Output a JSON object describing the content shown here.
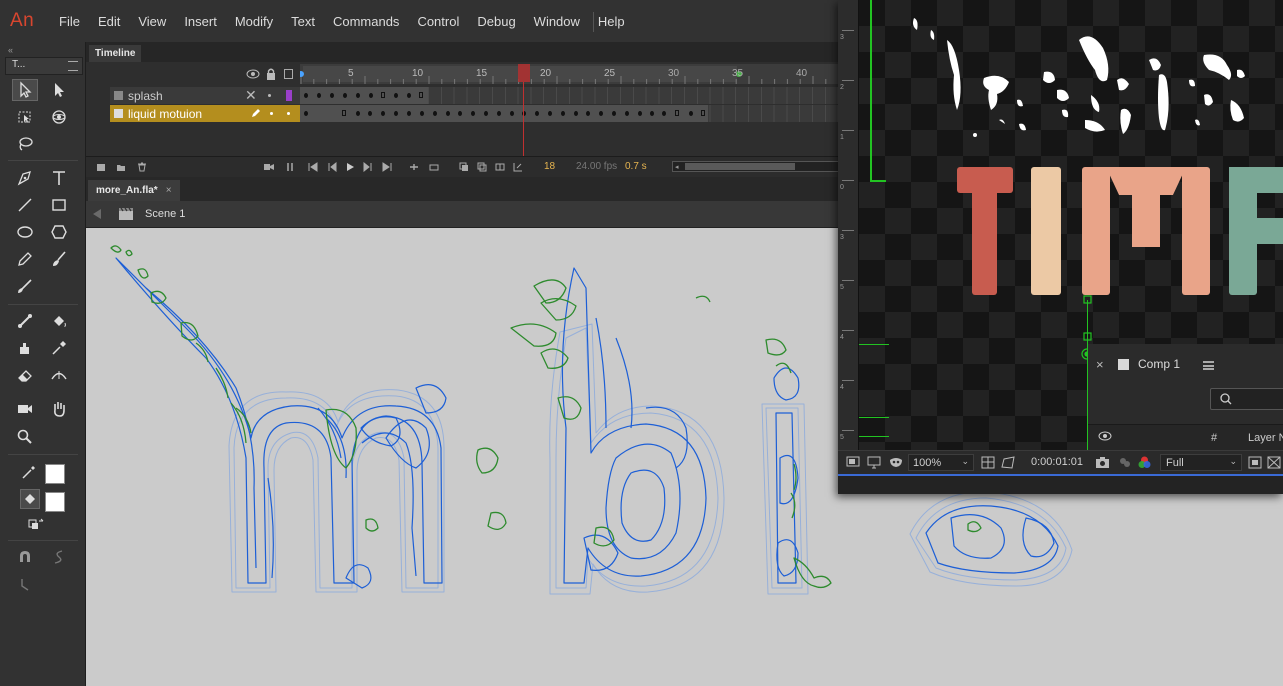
{
  "app": {
    "logo": "An"
  },
  "menu": {
    "items": [
      "File",
      "Edit",
      "View",
      "Insert",
      "Modify",
      "Text",
      "Commands",
      "Control",
      "Debug",
      "Window",
      "Help"
    ]
  },
  "tools": {
    "panel_title": "T...",
    "collapse": "«"
  },
  "timeline": {
    "tab_label": "Timeline",
    "ruler_marks": [
      "5",
      "10",
      "15",
      "20",
      "25",
      "30",
      "35",
      "40"
    ],
    "layers": [
      {
        "name": "splash",
        "selected": false,
        "color": "#9a3fc9"
      },
      {
        "name": "liquid motuion",
        "selected": true,
        "color": "#c5a31a"
      }
    ],
    "current_frame": "18",
    "fps": "24.00 fps",
    "time": "0.7 s"
  },
  "document": {
    "tab_label": "more_An.fla*",
    "tab_close": "×",
    "scene_label": "Scene 1"
  },
  "after_effects": {
    "viewer_text": "TIMI",
    "letter_colors": [
      "#c85c4f",
      "#ecc9a5",
      "#e9a489",
      "#e9a489",
      "#7aa896"
    ],
    "zoom": "100%",
    "timecode": "0:00:01:01",
    "resolution": "Full",
    "comp": {
      "close": "×",
      "title": "Comp 1",
      "column_hash": "#",
      "column_layer": "Layer N"
    },
    "ruler_numbers": [
      "3",
      "2",
      "1",
      "0",
      "3",
      "5",
      "4",
      "4",
      "5"
    ]
  },
  "colors": {
    "accent_logo": "#d8462f",
    "selected_layer_bg": "#b48e1e",
    "playhead": "#c03030",
    "stroke_blue": "#1d5fd6",
    "stroke_green": "#2e8b2e",
    "guide_green": "#22c322"
  }
}
